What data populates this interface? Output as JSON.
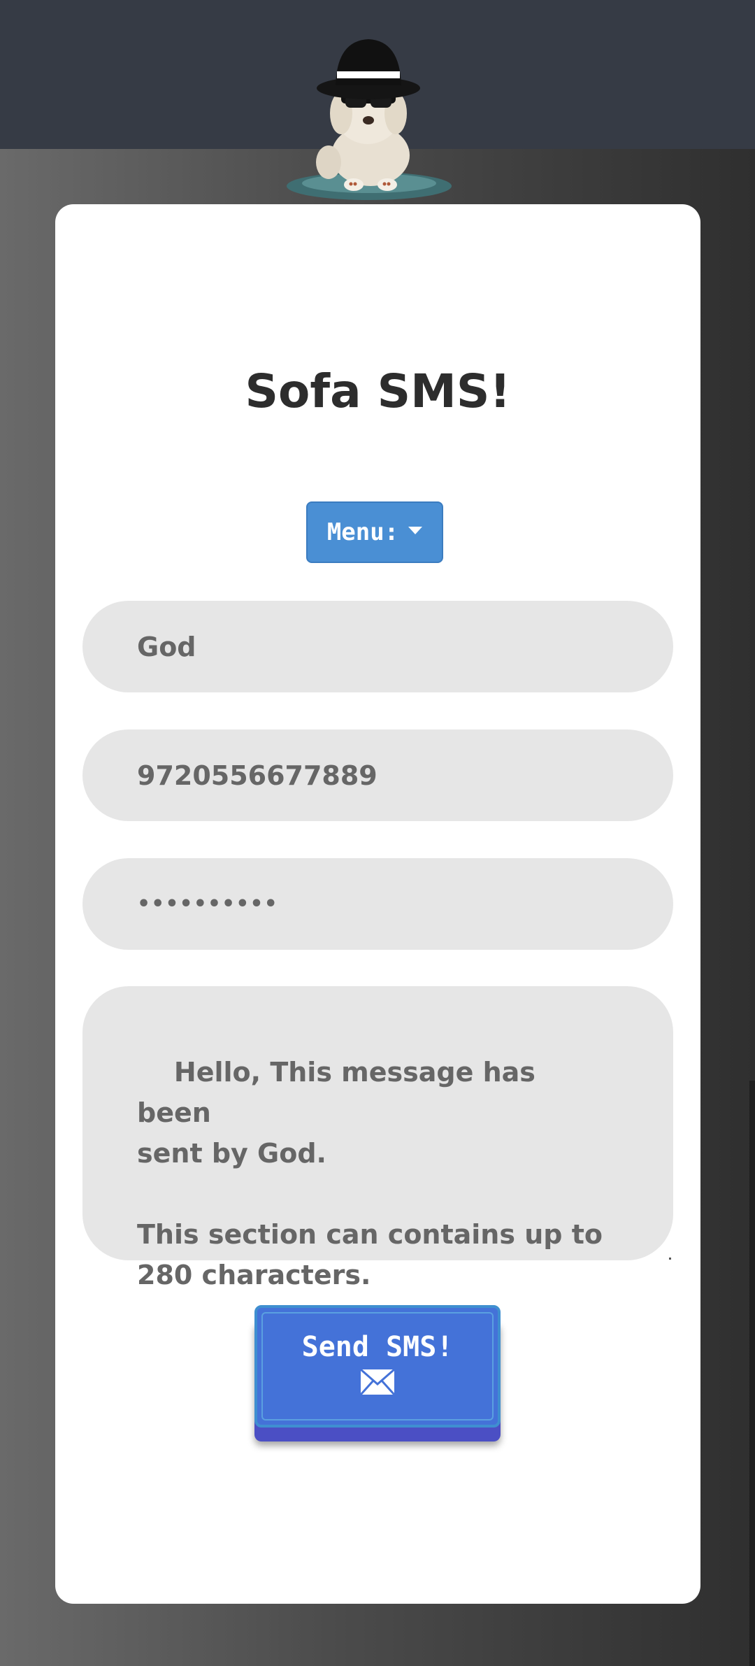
{
  "app": {
    "title": "Sofa SMS!"
  },
  "menu": {
    "label": "Menu:"
  },
  "form": {
    "sender_name": "God",
    "phone_number": "9720556677889",
    "password_masked": "••••••••••",
    "message": "Hello, This message has been\nsent by God.\n\nThis section can contains up to\n280 characters."
  },
  "send_button": {
    "label": "Send SMS!",
    "icon": "envelope-icon"
  },
  "icons": {
    "mascot": "dog-with-hat-icon",
    "menu_caret": "caret-down-icon"
  },
  "colors": {
    "header_bg": "#363b45",
    "card_bg": "#ffffff",
    "menu_button": "#4a8fd4",
    "send_button": "#4472d8",
    "input_bg": "#e6e6e6",
    "input_text": "#666666"
  }
}
